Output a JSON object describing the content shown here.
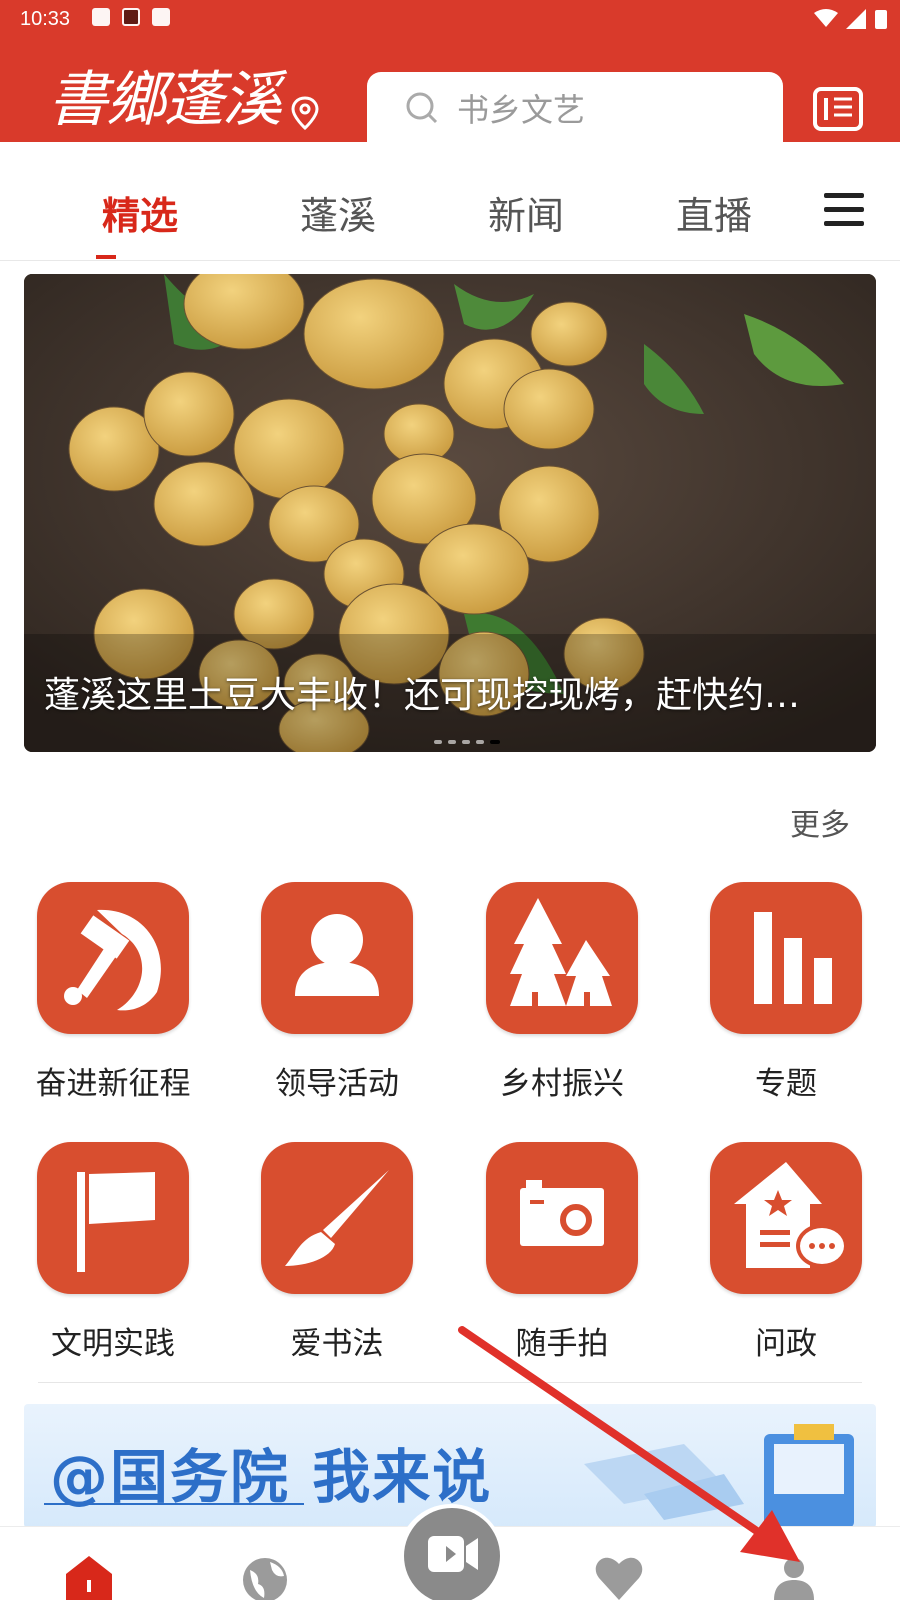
{
  "status_bar": {
    "time": "10:33"
  },
  "header": {
    "logo_text": "書鄉蓬溪",
    "search_placeholder": "书乡文艺"
  },
  "tabs": [
    {
      "label": "精选",
      "active": true
    },
    {
      "label": "蓬溪",
      "active": false
    },
    {
      "label": "新闻",
      "active": false
    },
    {
      "label": "直播",
      "active": false
    }
  ],
  "banner": {
    "caption": "蓬溪这里土豆大丰收！还可现挖现烤，赶快约…",
    "slide_count": 5,
    "active_slide": 5
  },
  "section": {
    "more_label": "更多"
  },
  "grid": [
    {
      "label": "奋进新征程",
      "icon": "hammer-sickle-icon"
    },
    {
      "label": "领导活动",
      "icon": "person-icon"
    },
    {
      "label": "乡村振兴",
      "icon": "trees-icon"
    },
    {
      "label": "专题",
      "icon": "bar-chart-icon"
    },
    {
      "label": "文明实践",
      "icon": "flag-icon"
    },
    {
      "label": "爱书法",
      "icon": "brush-icon"
    },
    {
      "label": "随手拍",
      "icon": "camera-icon"
    },
    {
      "label": "问政",
      "icon": "house-chat-icon"
    }
  ],
  "ad": {
    "text": "@国务院 我来说"
  },
  "bottom_nav": {
    "items": [
      "home-icon",
      "globe-icon",
      "video-icon",
      "heart-icon",
      "profile-icon"
    ]
  },
  "colors": {
    "brand_red": "#d93a2b",
    "tile": "#d84e2f",
    "active_tab": "#d8281a"
  }
}
